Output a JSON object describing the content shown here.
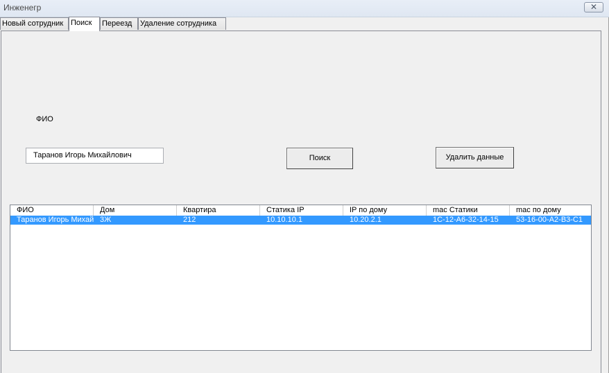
{
  "window": {
    "title": "Инженегр",
    "close_glyph": "✕"
  },
  "tabs": [
    {
      "label": "Новый сотрудник",
      "active": false
    },
    {
      "label": "Поиск",
      "active": true
    },
    {
      "label": "Переезд",
      "active": false
    },
    {
      "label": "Удаление сотрудника",
      "active": false
    }
  ],
  "search_form": {
    "fio_label": "ФИО",
    "fio_value": "Таранов Игорь Михайлович",
    "search_button": "Поиск",
    "delete_button": "Удалить данные"
  },
  "results": {
    "columns": [
      "ФИО",
      "Дом",
      "Квартира",
      "Статика IP",
      "IP по дому",
      "mac Статики",
      "mac по дому"
    ],
    "rows": [
      {
        "selected": true,
        "cells": [
          "Таранов Игорь Михайлович",
          "3Ж",
          "212",
          "10.10.10.1",
          "10.20.2.1",
          "1C-12-A6-32-14-15",
          "53-16-00-A2-B3-C1"
        ]
      }
    ]
  }
}
